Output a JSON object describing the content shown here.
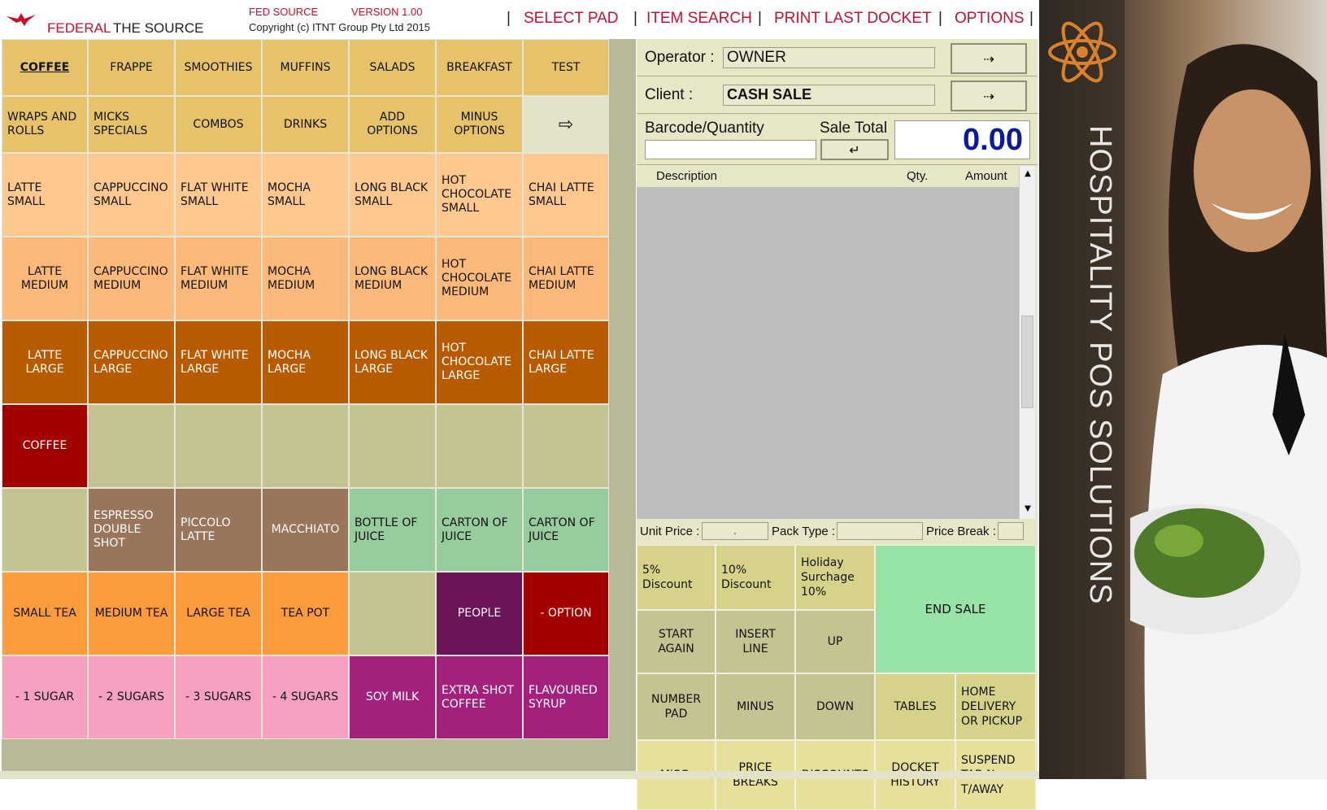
{
  "header": {
    "brand_left": "FEDERAL",
    "brand_right": "THE SOURCE",
    "product": "FED SOURCE",
    "version": "VERSION 1.00",
    "copyright": "Copyright (c) ITNT Group Pty Ltd 2015",
    "menu": [
      "SELECT PAD",
      "ITEM SEARCH",
      "PRINT LAST DOCKET",
      "OPTIONS"
    ],
    "separator": "|"
  },
  "pads": [
    [
      {
        "label": "COFFEE",
        "bg": "#e6c36a",
        "active": true
      },
      {
        "label": "FRAPPE",
        "bg": "#e6c36a"
      },
      {
        "label": "SMOOTHIES",
        "bg": "#e6c36a"
      },
      {
        "label": "MUFFINS",
        "bg": "#e6c36a"
      },
      {
        "label": "SALADS",
        "bg": "#e6c36a"
      },
      {
        "label": "BREAKFAST",
        "bg": "#e6c36a"
      },
      {
        "label": "TEST",
        "bg": "#e6c36a"
      }
    ],
    [
      {
        "label": "WRAPS AND\nROLLS",
        "bg": "#e6c36a",
        "align": "l"
      },
      {
        "label": "MICKS\nSPECIALS",
        "bg": "#e6c36a",
        "align": "l"
      },
      {
        "label": "COMBOS",
        "bg": "#e6c36a"
      },
      {
        "label": "DRINKS",
        "bg": "#e6c36a"
      },
      {
        "label": "ADD OPTIONS",
        "bg": "#e6c36a"
      },
      {
        "label": "MINUS\nOPTIONS",
        "bg": "#e6c36a"
      },
      {
        "label": "⇨",
        "bg": "#e3e3c9",
        "icon": true
      }
    ],
    [
      {
        "label": "LATTE\nSMALL",
        "bg": "#fec88f",
        "align": "l"
      },
      {
        "label": "CAPPUCCINO\nSMALL",
        "bg": "#fec88f",
        "align": "l"
      },
      {
        "label": "FLAT WHITE\nSMALL",
        "bg": "#fec88f",
        "align": "l"
      },
      {
        "label": "MOCHA\nSMALL",
        "bg": "#fec88f",
        "align": "l"
      },
      {
        "label": "LONG BLACK\nSMALL",
        "bg": "#fec88f",
        "align": "l"
      },
      {
        "label": "HOT\nCHOCOLATE\nSMALL",
        "bg": "#fec88f",
        "align": "l"
      },
      {
        "label": "CHAI LATTE\nSMALL",
        "bg": "#fec88f",
        "align": "l"
      }
    ],
    [
      {
        "label": "LATTE\nMEDIUM",
        "bg": "#fdb97a"
      },
      {
        "label": "CAPPUCCINO\nMEDIUM",
        "bg": "#fdb97a",
        "align": "l"
      },
      {
        "label": "FLAT WHITE\nMEDIUM",
        "bg": "#fdb97a",
        "align": "l"
      },
      {
        "label": "MOCHA\nMEDIUM",
        "bg": "#fdb97a",
        "align": "l"
      },
      {
        "label": "LONG BLACK\nMEDIUM",
        "bg": "#fdb97a",
        "align": "l"
      },
      {
        "label": "HOT\nCHOCOLATE\nMEDIUM",
        "bg": "#fdb97a",
        "align": "l"
      },
      {
        "label": "CHAI LATTE\nMEDIUM",
        "bg": "#fdb97a",
        "align": "l"
      }
    ],
    [
      {
        "label": "LATTE  LARGE",
        "bg": "#b85a00",
        "light": true
      },
      {
        "label": "CAPPUCCINO\nLARGE",
        "bg": "#b85a00",
        "align": "l",
        "light": true
      },
      {
        "label": "FLAT WHITE\nLARGE",
        "bg": "#b85a00",
        "align": "l",
        "light": true
      },
      {
        "label": "MOCHA\nLARGE",
        "bg": "#b85a00",
        "align": "l",
        "light": true
      },
      {
        "label": "LONG BLACK\nLARGE",
        "bg": "#b85a00",
        "align": "l",
        "light": true
      },
      {
        "label": "HOT\nCHOCOLATE\nLARGE",
        "bg": "#b85a00",
        "align": "l",
        "light": true
      },
      {
        "label": "CHAI LATTE\nLARGE",
        "bg": "#b85a00",
        "align": "l",
        "light": true
      }
    ],
    [
      {
        "label": "COFFEE",
        "bg": "#a30000",
        "light": true
      },
      {
        "label": "",
        "bg": "#c4c392"
      },
      {
        "label": "",
        "bg": "#c4c392"
      },
      {
        "label": "",
        "bg": "#c4c392"
      },
      {
        "label": "",
        "bg": "#c4c392"
      },
      {
        "label": "",
        "bg": "#c4c392"
      },
      {
        "label": "",
        "bg": "#c4c392"
      }
    ],
    [
      {
        "label": "",
        "bg": "#c4c392"
      },
      {
        "label": "ESPRESSO\nDOUBLE SHOT",
        "bg": "#99755c",
        "light": true,
        "align": "l"
      },
      {
        "label": "PICCOLO\nLATTE",
        "bg": "#99755c",
        "light": true,
        "align": "l"
      },
      {
        "label": "MACCHIATO",
        "bg": "#99755c",
        "light": true
      },
      {
        "label": "BOTTLE OF\nJUICE",
        "bg": "#97cc9e",
        "align": "l"
      },
      {
        "label": "CARTON OF\nJUICE",
        "bg": "#97cc9e",
        "align": "l"
      },
      {
        "label": "CARTON OF\nJUICE",
        "bg": "#97cc9e",
        "align": "l"
      }
    ],
    [
      {
        "label": "SMALL TEA",
        "bg": "#fd9c3d"
      },
      {
        "label": "MEDIUM TEA",
        "bg": "#fd9c3d"
      },
      {
        "label": "LARGE TEA",
        "bg": "#fd9c3d"
      },
      {
        "label": "TEA POT",
        "bg": "#fd9c3d"
      },
      {
        "label": "",
        "bg": "#c4c392"
      },
      {
        "label": "PEOPLE",
        "bg": "#6c1458",
        "light": true
      },
      {
        "label": "- OPTION",
        "bg": "#a30000",
        "light": true
      }
    ],
    [
      {
        "label": "- 1 SUGAR",
        "bg": "#f7a1c2"
      },
      {
        "label": "- 2 SUGARS",
        "bg": "#f7a1c2"
      },
      {
        "label": "- 3 SUGARS",
        "bg": "#f7a1c2"
      },
      {
        "label": "- 4 SUGARS",
        "bg": "#f7a1c2"
      },
      {
        "label": "SOY MILK",
        "bg": "#a3207d",
        "light": true
      },
      {
        "label": "EXTRA SHOT\nCOFFEE",
        "bg": "#a3207d",
        "light": true,
        "align": "l"
      },
      {
        "label": "FLAVOURED\nSYRUP",
        "bg": "#a3207d",
        "light": true,
        "align": "l"
      }
    ]
  ],
  "panel": {
    "operator_label": "Operator :",
    "operator_value": "OWNER",
    "client_label": "Client :",
    "client_value": "CASH SALE",
    "arrow_glyph": "⇢",
    "barcode_label": "Barcode/Quantity",
    "barcode_value": "",
    "sale_total_label": "Sale Total",
    "enter_glyph": "↵",
    "sale_total": "0.00",
    "col_desc": "Description",
    "col_qty": "Qty.",
    "col_amount": "Amount",
    "scroll_up": "▲",
    "scroll_down": "▼",
    "unit_price_label": "Unit Price :",
    "unit_price_value": ".",
    "pack_type_label": "Pack Type :",
    "pack_type_value": "",
    "price_break_label": "Price Break :",
    "price_break_value": ""
  },
  "functions": {
    "discount5": "5% Discount",
    "discount10": "10%\nDiscount",
    "holiday": "Holiday\nSurchage\n10%",
    "end_sale": "END SALE",
    "start_again": "START\nAGAIN",
    "insert_line": "INSERT\nLINE",
    "up": "UP",
    "number_pad": "NUMBER\nPAD",
    "minus": "MINUS",
    "down": "DOWN",
    "tables": "TABLES",
    "home_delivery": "HOME\nDELIVERY\nOR PICKUP",
    "misc": "MISC.",
    "price_breaks": "PRICE\nBREAKS",
    "discounts": "DISCOUNTS",
    "docket_history": "DOCKET\nHISTORY",
    "suspend_tab": "SUSPEND\nTAB No.\nT/AWAY"
  },
  "banner": {
    "text": "HOSPITALITY POS SOLUTIONS",
    "logo_icon": "atom-icon"
  },
  "colors": {
    "header_red": "#c8102e",
    "end_sale_green": "#98e3a8",
    "function_olive": "#d6d28a",
    "total_blue": "#0a1a9a"
  }
}
